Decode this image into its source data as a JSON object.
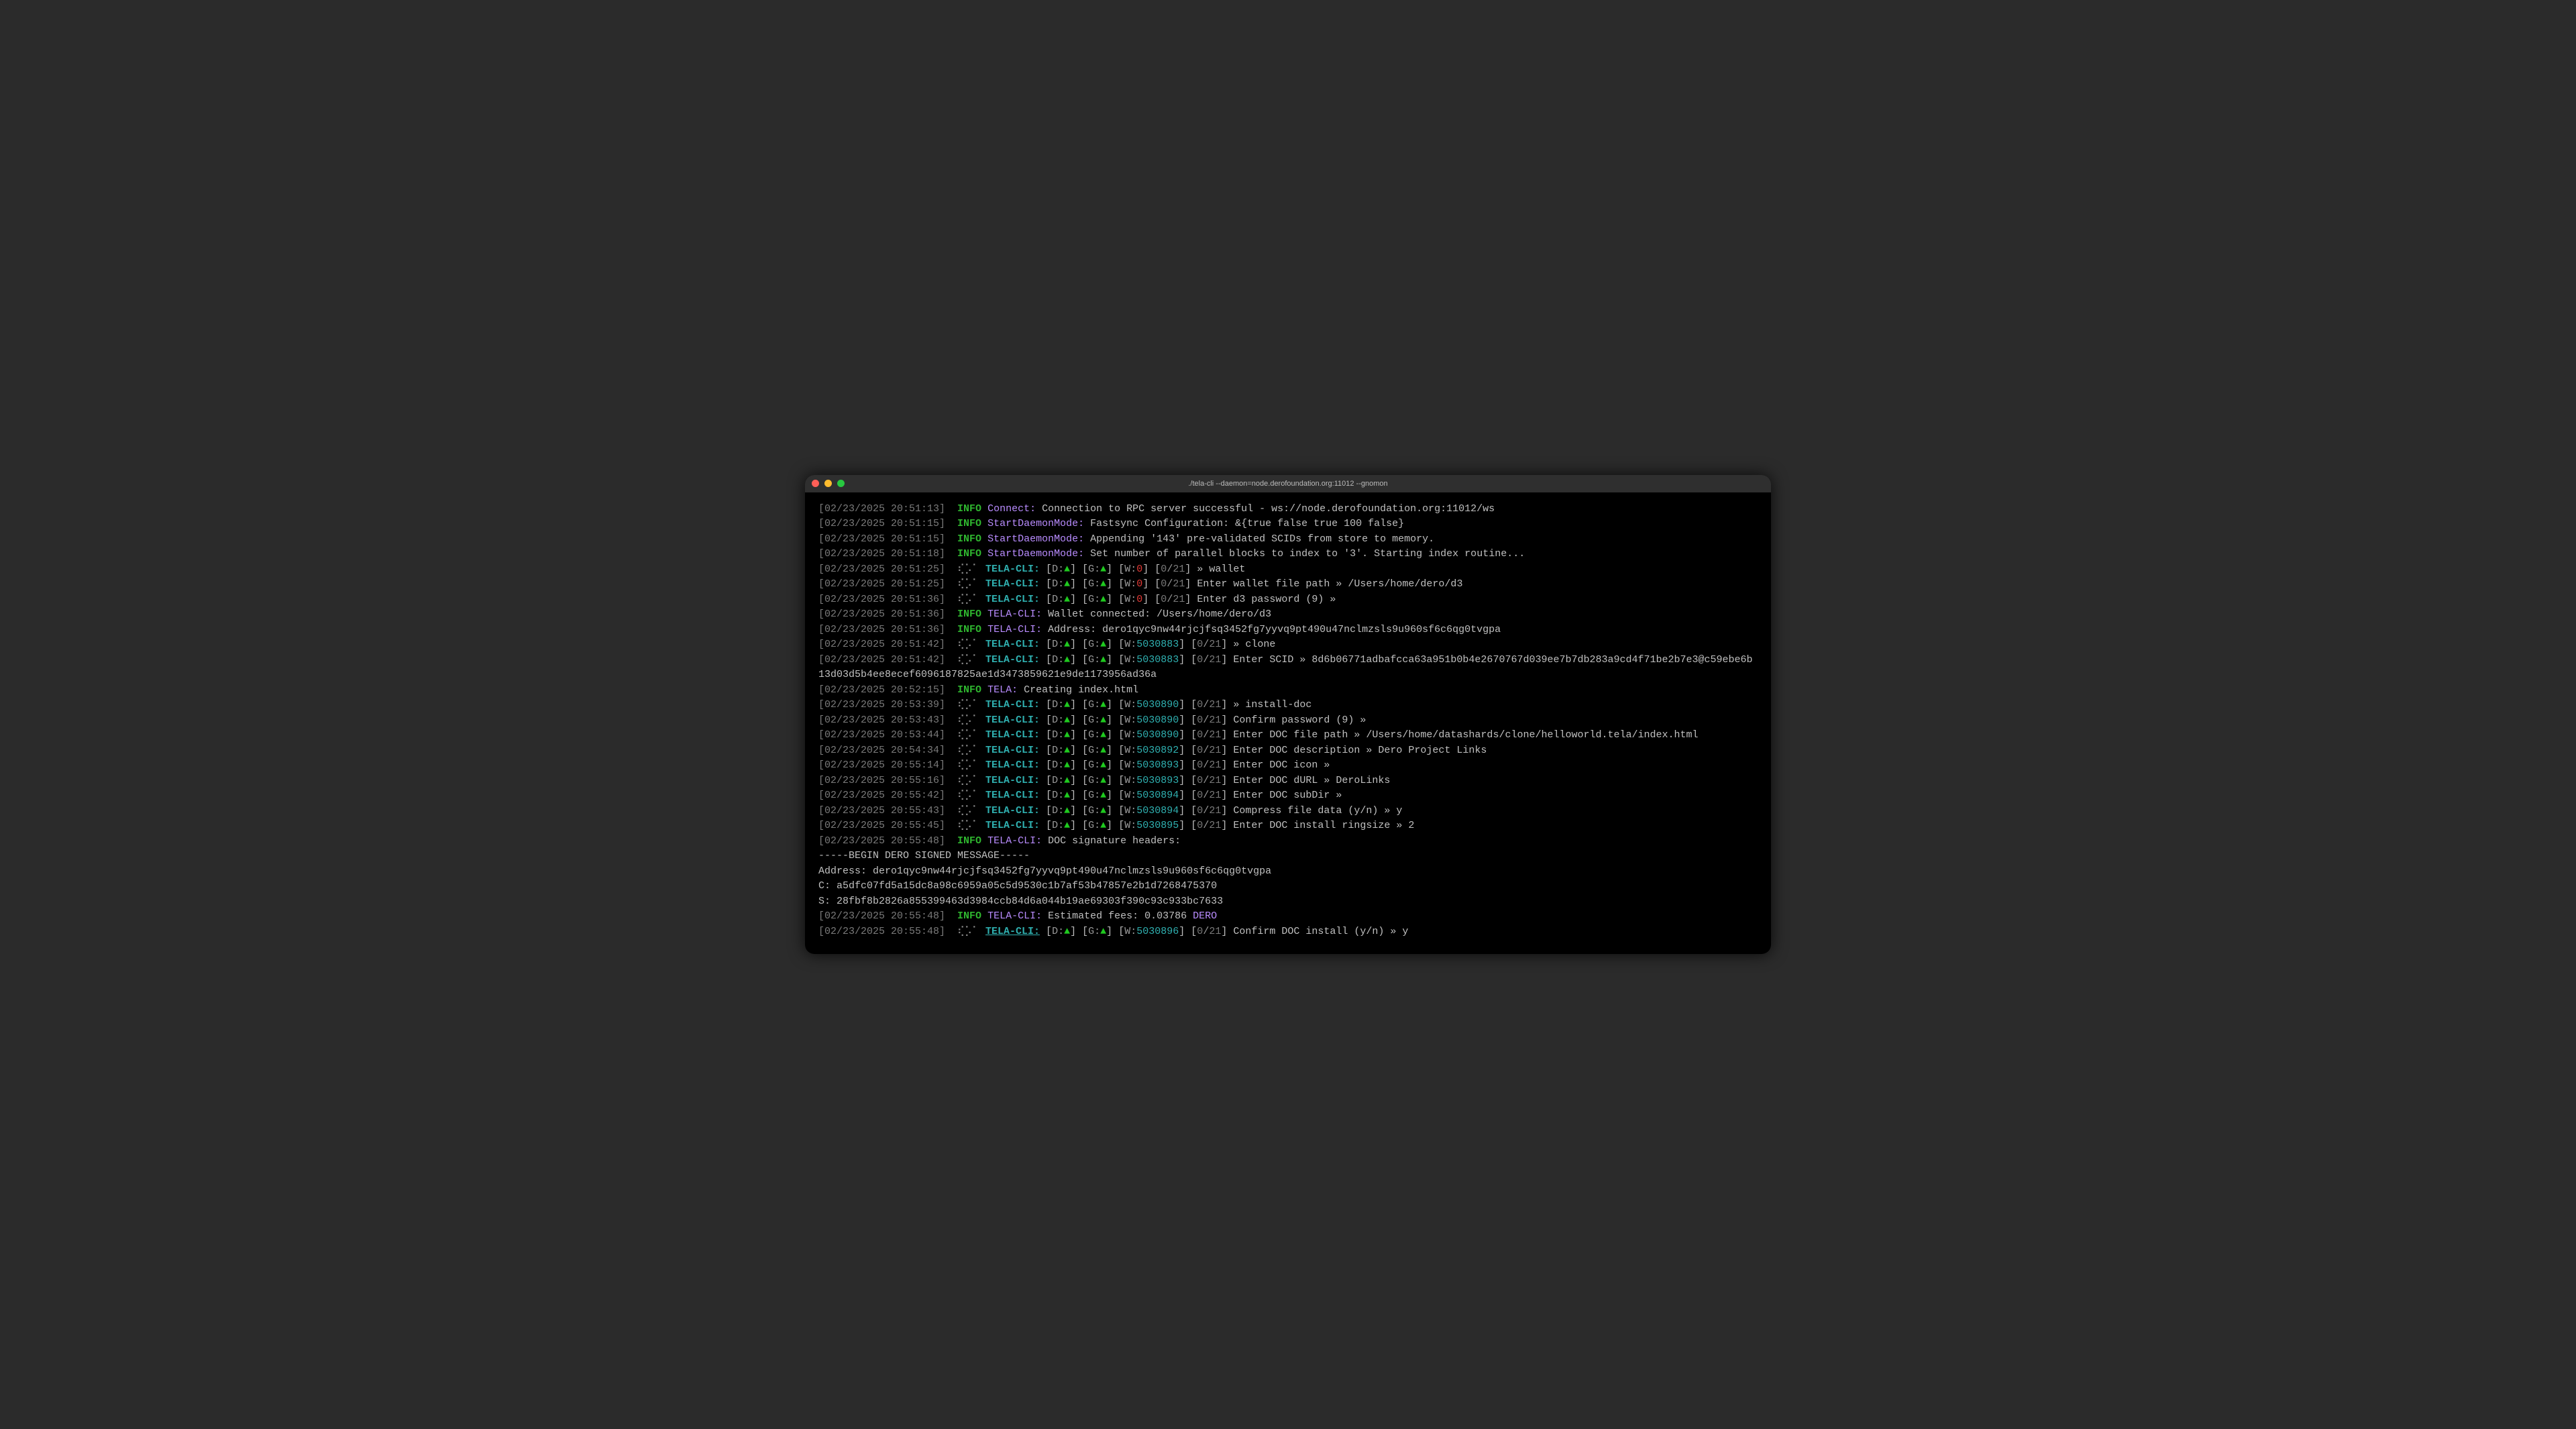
{
  "title": "./tela-cli --daemon=node.derofoundation.org:11012 --gnomon",
  "lines": [
    {
      "ts": "[02/23/2025 20:51:13]",
      "type": "info",
      "source": "Connect:",
      "msg": "Connection to RPC server successful - ws://node.derofoundation.org:11012/ws"
    },
    {
      "ts": "[02/23/2025 20:51:15]",
      "type": "info",
      "source": "StartDaemonMode:",
      "msg": "Fastsync Configuration: &{true false true 100 false}"
    },
    {
      "ts": "[02/23/2025 20:51:15]",
      "type": "info",
      "source": "StartDaemonMode:",
      "msg": "Appending '143' pre-validated SCIDs from store to memory."
    },
    {
      "ts": "[02/23/2025 20:51:18]",
      "type": "info",
      "source": "StartDaemonMode:",
      "msg": "Set number of parallel blocks to index to '3'. Starting index routine..."
    },
    {
      "ts": "[02/23/2025 20:51:25]",
      "type": "cli",
      "w": "0",
      "wclass": "w-red",
      "count": "0/21",
      "prompt": "» wallet"
    },
    {
      "ts": "[02/23/2025 20:51:25]",
      "type": "cli",
      "w": "0",
      "wclass": "w-red",
      "count": "0/21",
      "prompt": "Enter wallet file path » /Users/home/dero/d3"
    },
    {
      "ts": "[02/23/2025 20:51:36]",
      "type": "cli",
      "w": "0",
      "wclass": "w-red",
      "count": "0/21",
      "prompt": "Enter d3 password (9) »"
    },
    {
      "ts": "[02/23/2025 20:51:36]",
      "type": "info",
      "source": "TELA-CLI:",
      "msg": "Wallet connected: /Users/home/dero/d3"
    },
    {
      "ts": "[02/23/2025 20:51:36]",
      "type": "info",
      "source": "TELA-CLI:",
      "msg": "Address: dero1qyc9nw44rjcjfsq3452fg7yyvq9pt490u47nclmzsls9u960sf6c6qg0tvgpa"
    },
    {
      "ts": "[02/23/2025 20:51:42]",
      "type": "cli",
      "w": "5030883",
      "wclass": "w-num",
      "count": "0/21",
      "prompt": "» clone"
    },
    {
      "ts": "[02/23/2025 20:51:42]",
      "type": "cli",
      "w": "5030883",
      "wclass": "w-num",
      "count": "0/21",
      "prompt": "Enter SCID » 8d6b06771adbafcca63a951b0b4e2670767d039ee7b7db283a9cd4f71be2b7e3@c59ebe6b13d03d5b4ee8ecef6096187825ae1d3473859621e9de1173956ad36a"
    },
    {
      "ts": "[02/23/2025 20:52:15]",
      "type": "info",
      "source": "TELA:",
      "msg": "Creating index.html"
    },
    {
      "ts": "[02/23/2025 20:53:39]",
      "type": "cli",
      "w": "5030890",
      "wclass": "w-num",
      "count": "0/21",
      "prompt": "» install-doc"
    },
    {
      "ts": "[02/23/2025 20:53:43]",
      "type": "cli",
      "w": "5030890",
      "wclass": "w-num",
      "count": "0/21",
      "prompt": "Confirm password (9) »"
    },
    {
      "ts": "[02/23/2025 20:53:44]",
      "type": "cli",
      "w": "5030890",
      "wclass": "w-num",
      "count": "0/21",
      "prompt": "Enter DOC file path » /Users/home/datashards/clone/helloworld.tela/index.html"
    },
    {
      "ts": "[02/23/2025 20:54:34]",
      "type": "cli",
      "w": "5030892",
      "wclass": "w-num",
      "count": "0/21",
      "prompt": "Enter DOC description » Dero Project Links"
    },
    {
      "ts": "[02/23/2025 20:55:14]",
      "type": "cli",
      "w": "5030893",
      "wclass": "w-num",
      "count": "0/21",
      "prompt": "Enter DOC icon »"
    },
    {
      "ts": "[02/23/2025 20:55:16]",
      "type": "cli",
      "w": "5030893",
      "wclass": "w-num",
      "count": "0/21",
      "prompt": "Enter DOC dURL » DeroLinks"
    },
    {
      "ts": "[02/23/2025 20:55:42]",
      "type": "cli",
      "w": "5030894",
      "wclass": "w-num",
      "count": "0/21",
      "prompt": "Enter DOC subDir »"
    },
    {
      "ts": "[02/23/2025 20:55:43]",
      "type": "cli",
      "w": "5030894",
      "wclass": "w-num",
      "count": "0/21",
      "prompt": "Compress file data (y/n) » y"
    },
    {
      "ts": "[02/23/2025 20:55:45]",
      "type": "cli",
      "w": "5030895",
      "wclass": "w-num",
      "count": "0/21",
      "prompt": "Enter DOC install ringsize » 2"
    },
    {
      "ts": "[02/23/2025 20:55:48]",
      "type": "info",
      "source": "TELA-CLI:",
      "msg": "DOC signature headers:"
    },
    {
      "type": "plain",
      "text": "-----BEGIN DERO SIGNED MESSAGE-----"
    },
    {
      "type": "plain",
      "text": "Address: dero1qyc9nw44rjcjfsq3452fg7yyvq9pt490u47nclmzsls9u960sf6c6qg0tvgpa"
    },
    {
      "type": "plain",
      "text": "C: a5dfc07fd5a15dc8a98c6959a05c5d9530c1b7af53b47857e2b1d7268475370"
    },
    {
      "type": "plain",
      "text": "S: 28fbf8b2826a855399463d3984ccb84d6a044b19ae69303f390c93c933bc7633"
    },
    {
      "ts": "[02/23/2025 20:55:48]",
      "type": "info-deri",
      "source": "TELA-CLI:",
      "msg": "Estimated fees: 0.03786 ",
      "dero": "DERO"
    },
    {
      "ts": "[02/23/2025 20:55:48]",
      "type": "cli-u",
      "w": "5030896",
      "wclass": "w-num",
      "count": "0/21",
      "prompt": "Confirm DOC install (y/n) » y"
    }
  ],
  "labels": {
    "info": "INFO",
    "tela": "TELA-CLI:",
    "dotsCli": "⢎⡡⠁",
    "d": "D:",
    "g": "G:",
    "w": "W:",
    "tri": "▲"
  }
}
